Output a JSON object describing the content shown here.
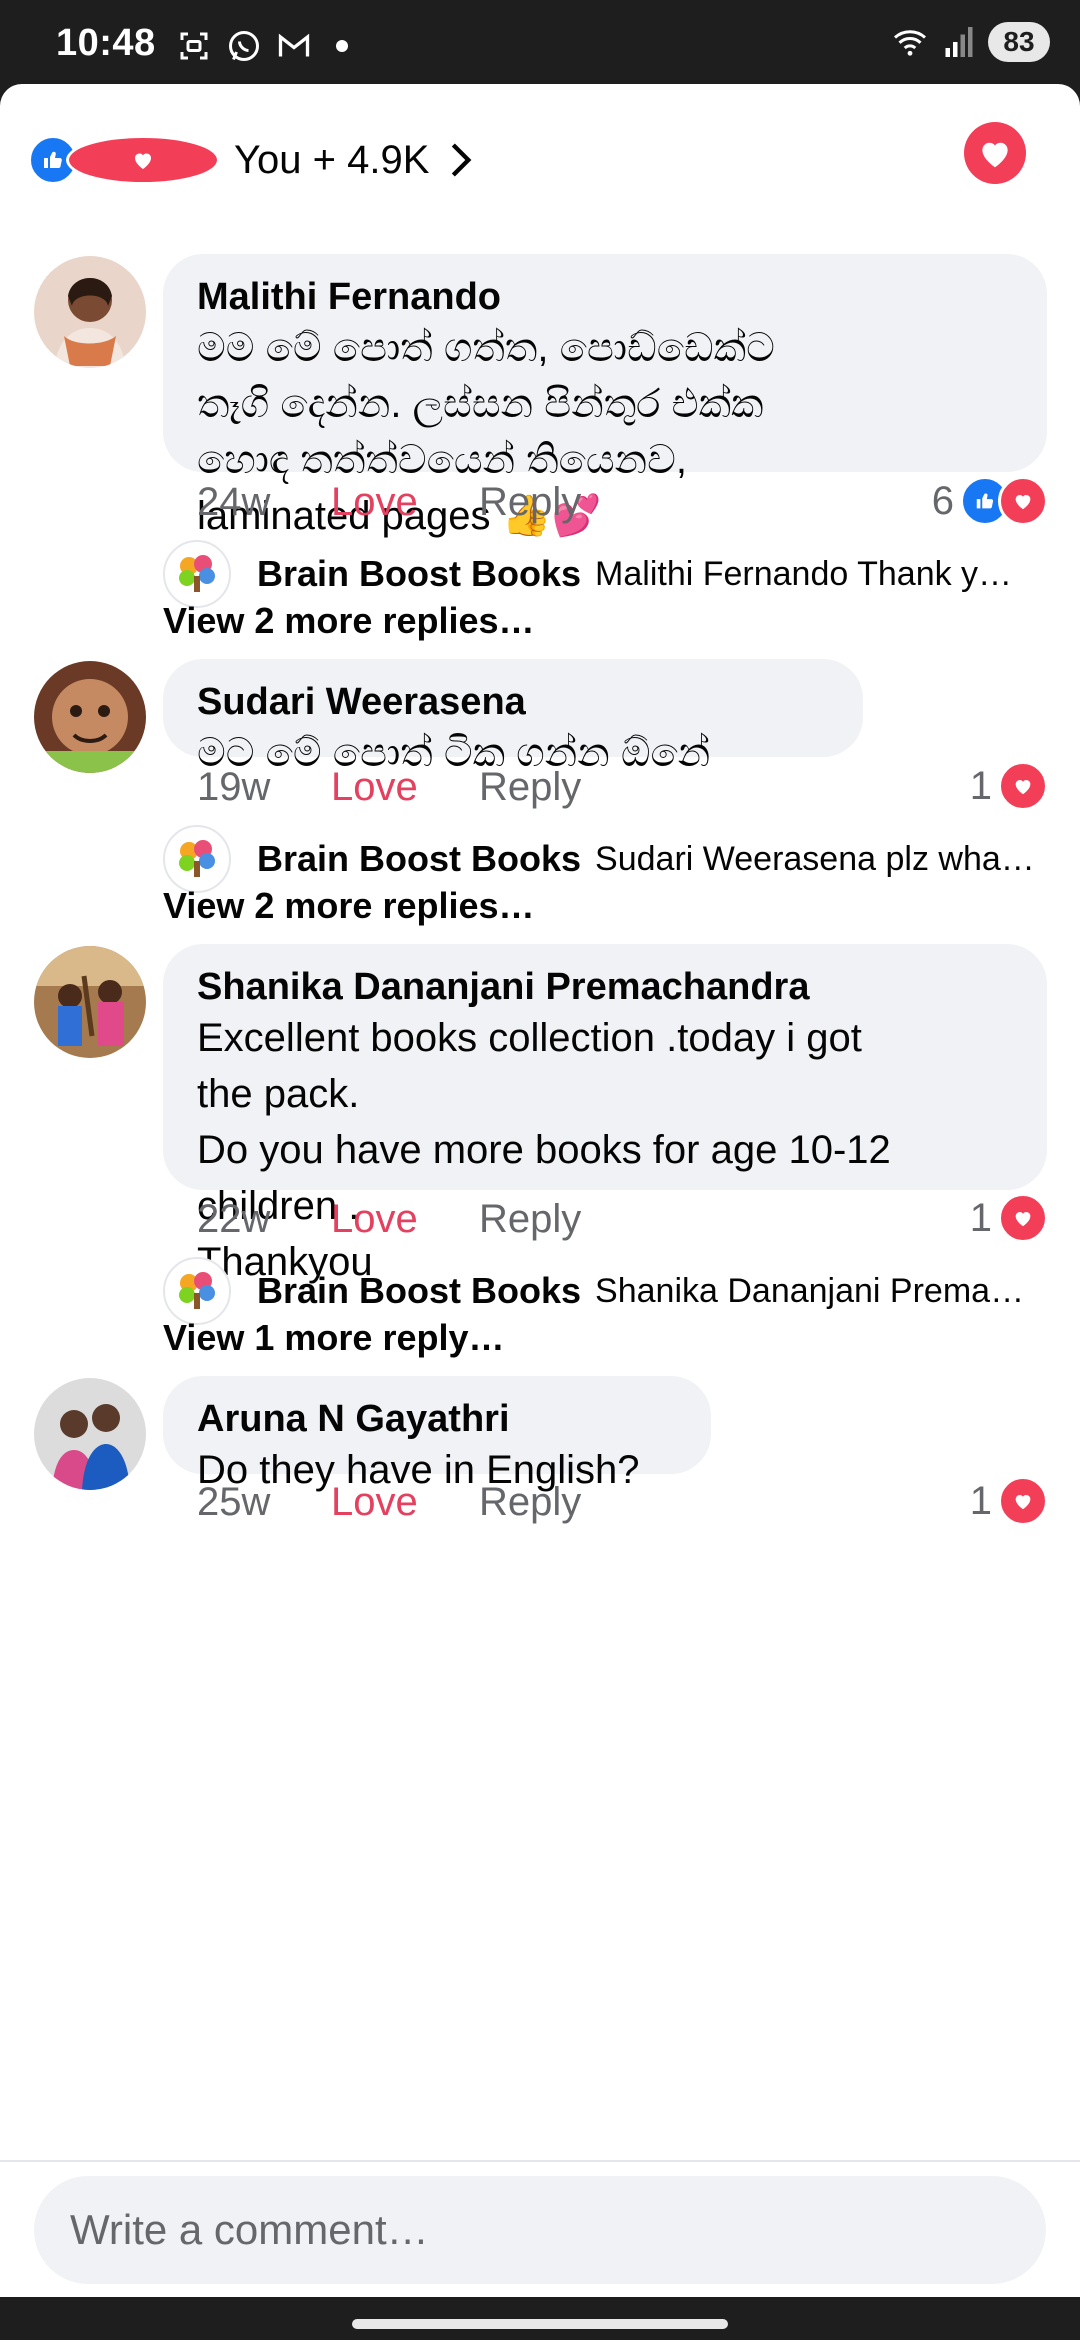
{
  "status_bar": {
    "time": "10:48",
    "battery": "83",
    "icons": [
      "screenshot-icon",
      "whatsapp-icon",
      "gmail-icon",
      "dot-icon",
      "wifi-icon",
      "signal-icon"
    ]
  },
  "header": {
    "reactions_count": "You + 4.9K"
  },
  "comments": [
    {
      "author": "Malithi Fernando",
      "text": "මම මේ පොත් ගත්ත, පොඩ්ඩෙක්ට\nතෑගි දෙන්න. ලස්සන පින්තුර එක්ක\nහොඳ තත්ත්වයෙන් තියෙනව,\nlaminated pages 👍💕",
      "time": "24w",
      "love": "Love",
      "reply": "Reply",
      "reaction_count": "6",
      "reply_preview": {
        "author": "Brain Boost Books",
        "text": "Malithi Fernando Thank y…"
      },
      "view_more": "View 2 more replies…"
    },
    {
      "author": "Sudari Weerasena",
      "text": "මට මේ පොත් ටික ගන්න ඕනේ",
      "time": "19w",
      "love": "Love",
      "reply": "Reply",
      "reaction_count": "1",
      "reply_preview": {
        "author": "Brain Boost Books",
        "text": "Sudari Weerasena plz wha…"
      },
      "view_more": "View 2 more replies…"
    },
    {
      "author": "Shanika Dananjani Premachandra",
      "text": "Excellent books collection .today i got\nthe pack.\nDo you have more books for age 10-12\nchildren .\nThankyou",
      "time": "22w",
      "love": "Love",
      "reply": "Reply",
      "reaction_count": "1",
      "reply_preview": {
        "author": "Brain Boost Books",
        "text": "Shanika Dananjani Prema…"
      },
      "view_more": "View 1 more reply…"
    },
    {
      "author": "Aruna N Gayathri",
      "text": "Do they have in English?",
      "time": "25w",
      "love": "Love",
      "reply": "Reply",
      "reaction_count": "1"
    }
  ],
  "composer": {
    "placeholder": "Write a comment…"
  },
  "colors": {
    "like_blue": "#1877f2",
    "love_red": "#f33e58",
    "love_text": "#e4405f",
    "bubble_bg": "#f0f2f5",
    "secondary_text": "#65676b"
  }
}
